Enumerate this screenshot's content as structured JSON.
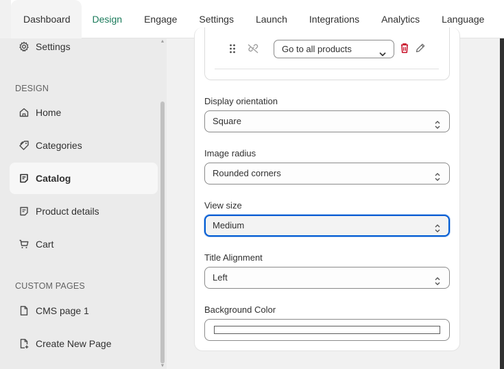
{
  "topnav": {
    "tabs": [
      {
        "label": "Dashboard"
      },
      {
        "label": "Design"
      },
      {
        "label": "Engage"
      },
      {
        "label": "Settings"
      },
      {
        "label": "Launch"
      },
      {
        "label": "Integrations"
      },
      {
        "label": "Analytics"
      },
      {
        "label": "Language"
      }
    ],
    "active_tab": "Design"
  },
  "sidebar": {
    "settings_label": "Settings",
    "design_section": "DESIGN",
    "items": [
      {
        "label": "Home",
        "icon": "home-icon"
      },
      {
        "label": "Categories",
        "icon": "tag-icon"
      },
      {
        "label": "Catalog",
        "icon": "catalog-icon"
      },
      {
        "label": "Product details",
        "icon": "document-icon"
      },
      {
        "label": "Cart",
        "icon": "cart-icon"
      }
    ],
    "active_item": "Catalog",
    "custom_section": "CUSTOM PAGES",
    "custom_items": [
      {
        "label": "CMS page 1",
        "icon": "page-icon"
      },
      {
        "label": "Create New Page",
        "icon": "page-add-icon"
      }
    ]
  },
  "main": {
    "link_select_value": "Go to all products",
    "fields": {
      "display_orientation": {
        "label": "Display orientation",
        "value": "Square"
      },
      "image_radius": {
        "label": "Image radius",
        "value": "Rounded corners"
      },
      "view_size": {
        "label": "View size",
        "value": "Medium"
      },
      "title_alignment": {
        "label": "Title Alignment",
        "value": "Left"
      },
      "background_color": {
        "label": "Background Color",
        "value": "#ffffff"
      }
    }
  },
  "colors": {
    "accent_active_tab": "#1a7a5a",
    "focus_ring": "#005bd3",
    "delete_icon": "#c70a24"
  }
}
